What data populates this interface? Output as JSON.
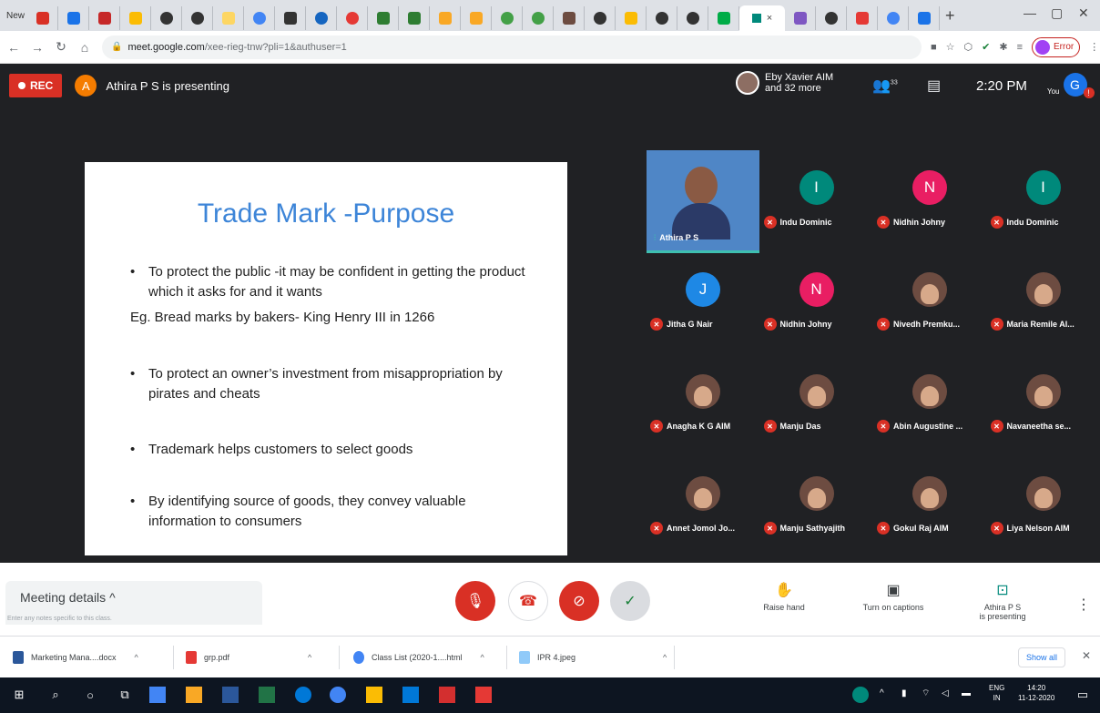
{
  "browser": {
    "new_tab_label": "New",
    "active_tab_close": "×",
    "new_tab_plus": "+",
    "url_host": "meet.google.com",
    "url_path": "/xee-rieg-tnw?pli=1&authuser=1",
    "error_label": "Error"
  },
  "meet": {
    "rec_label": "REC",
    "presenter_initial": "A",
    "presenting_text": "Athira P S is presenting",
    "participants_line1": "Eby Xavier AIM",
    "participants_line2": "and 32 more",
    "participant_count": "33",
    "time": "2:20 PM",
    "you_label": "You",
    "account_initial": "G",
    "notification_count": "!"
  },
  "slide": {
    "title": "Trade Mark -Purpose",
    "bullet1": "To protect the public -it may be confident in getting the product which it asks for and it wants",
    "example": "Eg. Bread marks by bakers- King Henry III in 1266",
    "bullet2": "To protect an owner’s investment from misappropriation by pirates and cheats",
    "bullet3": "Trademark helps customers to select goods",
    "bullet4": "By identifying source of goods, they convey valuable information to consumers"
  },
  "tiles": {
    "self_name": "Athira P S",
    "items": [
      {
        "name": "Indu Dominic",
        "initial": "I",
        "color": "#00897b"
      },
      {
        "name": "Nidhin Johny",
        "initial": "N",
        "color": "#e91e63"
      },
      {
        "name": "Indu Dominic",
        "initial": "I",
        "color": "#00897b"
      },
      {
        "name": "Jitha G Nair",
        "initial": "J",
        "color": "#1e88e5"
      },
      {
        "name": "Nidhin Johny",
        "initial": "N",
        "color": "#e91e63"
      },
      {
        "name": "Nivedh Premku...",
        "initial": "",
        "color": "#6d4c41"
      },
      {
        "name": "Maria Remile Al...",
        "initial": "",
        "color": "#6d4c41"
      },
      {
        "name": "Anagha K G AIM",
        "initial": "",
        "color": "#6d4c41"
      },
      {
        "name": "Manju Das",
        "initial": "",
        "color": "#6d4c41"
      },
      {
        "name": "Abin Augustine ...",
        "initial": "",
        "color": "#6d4c41"
      },
      {
        "name": "Navaneetha se...",
        "initial": "",
        "color": "#6d4c41"
      },
      {
        "name": "Annet Jomol Jo...",
        "initial": "",
        "color": "#6d4c41"
      },
      {
        "name": "Manju Sathyajith",
        "initial": "",
        "color": "#6d4c41"
      },
      {
        "name": "Gokul Raj AIM",
        "initial": "",
        "color": "#6d4c41"
      },
      {
        "name": "Liya Nelson AIM",
        "initial": "",
        "color": "#6d4c41"
      }
    ]
  },
  "controls": {
    "meeting_details": "Meeting details",
    "notes_placeholder": "Enter any notes specific to this class.",
    "raise_hand": "Raise hand",
    "captions": "Turn on captions",
    "presenting_line1": "Athira P S",
    "presenting_line2": "is presenting"
  },
  "downloads": {
    "items": [
      "Marketing Mana....docx",
      "grp.pdf",
      "Class List (2020-1....html",
      "IPR 4.jpeg"
    ],
    "show_all": "Show all"
  },
  "taskbar": {
    "lang_top": "ENG",
    "lang_bottom": "IN",
    "clock_time": "14:20",
    "clock_date": "11-12-2020"
  },
  "colors": {
    "rec": "#d93025",
    "slide_title": "#3d85d8",
    "end_call": "#ffffff",
    "check_btn": "#dadce0"
  }
}
